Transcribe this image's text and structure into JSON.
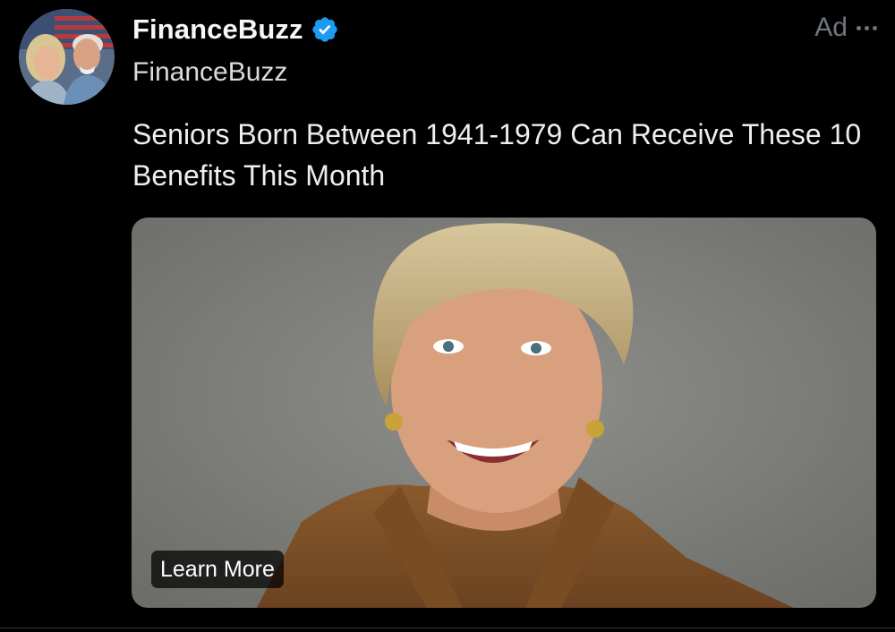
{
  "post": {
    "author": {
      "display_name": "FinanceBuzz",
      "handle": "FinanceBuzz",
      "verified": true,
      "avatar_icon": "couple-avatar"
    },
    "ad_label": "Ad",
    "more_icon": "more-horizontal-icon",
    "text": "Seniors Born Between 1941-1979 Can Receive These 10 Benefits This Month",
    "media": {
      "image": "smiling-woman-photo",
      "cta_label": "Learn More"
    }
  },
  "colors": {
    "background": "#000000",
    "text_primary": "#e7e9ea",
    "text_secondary": "#71767b",
    "verified_badge": "#1d9bf0",
    "divider": "#2f3336"
  }
}
